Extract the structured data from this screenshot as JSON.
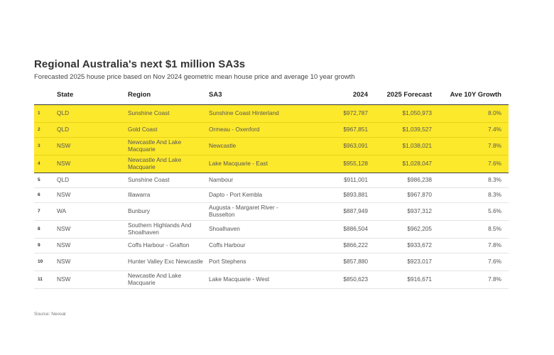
{
  "title": "Regional Australia's next $1 million SA3s",
  "subtitle": "Forecasted 2025 house price based on Nov 2024 geometric mean house price and average 10 year growth",
  "source": "Source: Neoval",
  "colors": {
    "highlight": "#fde92b",
    "text": "#555555",
    "header": "#222222"
  },
  "chart_data": {
    "type": "table",
    "columns": [
      "",
      "State",
      "Region",
      "SA3",
      "2024",
      "2025 Forecast",
      "Ave 10Y Growth"
    ],
    "highlighted_rows": [
      1,
      2,
      3,
      4
    ],
    "rows": [
      {
        "rank": "1",
        "state": "QLD",
        "region": "Sunshine Coast",
        "sa3": "Sunshine Coast Hinterland",
        "p2024": "$972,787",
        "p2025": "$1,050,973",
        "growth": "8.0%"
      },
      {
        "rank": "2",
        "state": "QLD",
        "region": "Gold Coast",
        "sa3": "Ormeau - Oxenford",
        "p2024": "$967,851",
        "p2025": "$1,039,527",
        "growth": "7.4%"
      },
      {
        "rank": "3",
        "state": "NSW",
        "region": "Newcastle And Lake Macquarie",
        "sa3": "Newcastle",
        "p2024": "$963,091",
        "p2025": "$1,038,021",
        "growth": "7.8%"
      },
      {
        "rank": "4",
        "state": "NSW",
        "region": "Newcastle And Lake Macquarie",
        "sa3": "Lake Macquarie - East",
        "p2024": "$955,128",
        "p2025": "$1,028,047",
        "growth": "7.6%"
      },
      {
        "rank": "5",
        "state": "QLD",
        "region": "Sunshine Coast",
        "sa3": "Nambour",
        "p2024": "$911,001",
        "p2025": "$986,238",
        "growth": "8.3%"
      },
      {
        "rank": "6",
        "state": "NSW",
        "region": "Illawarra",
        "sa3": "Dapto - Port Kembla",
        "p2024": "$893,881",
        "p2025": "$967,870",
        "growth": "8.3%"
      },
      {
        "rank": "7",
        "state": "WA",
        "region": "Bunbury",
        "sa3": "Augusta - Margaret River - Busselton",
        "p2024": "$887,949",
        "p2025": "$937,312",
        "growth": "5.6%"
      },
      {
        "rank": "8",
        "state": "NSW",
        "region": "Southern Highlands And Shoalhaven",
        "sa3": "Shoalhaven",
        "p2024": "$886,504",
        "p2025": "$962,205",
        "growth": "8.5%"
      },
      {
        "rank": "9",
        "state": "NSW",
        "region": "Coffs Harbour - Grafton",
        "sa3": "Coffs Harbour",
        "p2024": "$866,222",
        "p2025": "$933,672",
        "growth": "7.8%"
      },
      {
        "rank": "10",
        "state": "NSW",
        "region": "Hunter Valley Exc Newcastle",
        "sa3": "Port Stephens",
        "p2024": "$857,880",
        "p2025": "$923,017",
        "growth": "7.6%"
      },
      {
        "rank": "11",
        "state": "NSW",
        "region": "Newcastle And Lake Macquarie",
        "sa3": "Lake Macquarie - West",
        "p2024": "$850,623",
        "p2025": "$916,671",
        "growth": "7.8%"
      }
    ]
  }
}
